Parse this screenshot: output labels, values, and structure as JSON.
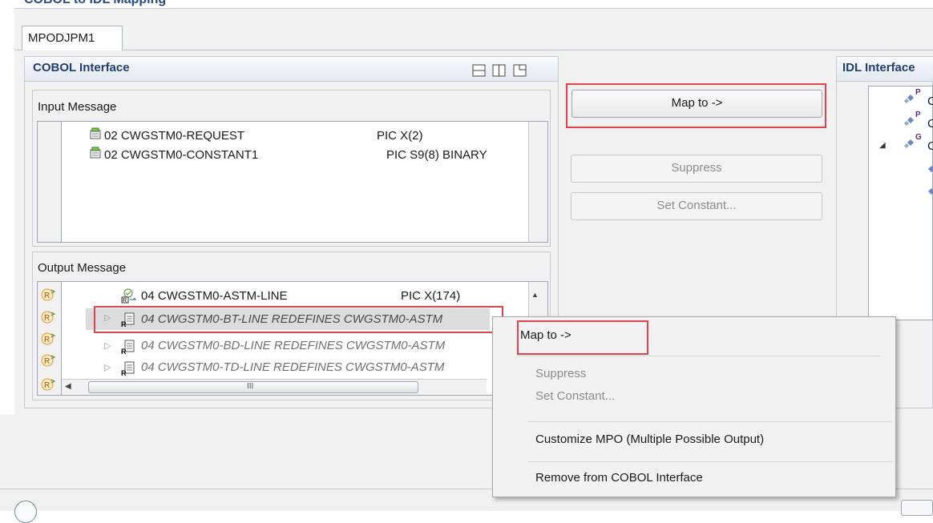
{
  "header": {
    "title": "COBOL to IDL Mapping"
  },
  "tab": {
    "label": "MPODJPM1"
  },
  "cobol": {
    "title": "COBOL Interface",
    "input": {
      "label": "Input Message",
      "rows": [
        {
          "name": "02 CWGSTM0-REQUEST",
          "pic": "PIC X(2)"
        },
        {
          "name": "02 CWGSTM0-CONSTANT1",
          "pic": "PIC S9(8) BINARY"
        }
      ]
    },
    "output": {
      "label": "Output Message",
      "rows": [
        {
          "name": "04 CWGSTM0-ASTM-LINE",
          "pic": "PIC X(174)"
        },
        {
          "name": "04 CWGSTM0-BT-LINE REDEFINES CWGSTM0-ASTM"
        },
        {
          "name": "04 CWGSTM0-BD-LINE REDEFINES CWGSTM0-ASTM"
        },
        {
          "name": "04 CWGSTM0-TD-LINE REDEFINES CWGSTM0-ASTM"
        }
      ],
      "scroll_grip": "III"
    }
  },
  "buttons": {
    "map_to": "Map to ->",
    "suppress": "Suppress",
    "set_constant": "Set Constant..."
  },
  "idl": {
    "title": "IDL Interface",
    "rows": [
      {
        "badge": "P",
        "text": "C"
      },
      {
        "badge": "P",
        "text": "C"
      },
      {
        "badge": "G",
        "text": "C"
      }
    ]
  },
  "context_menu": {
    "items": [
      "Map to ->",
      "Suppress",
      "Set Constant...",
      "Customize MPO (Multiple Possible Output)",
      "Remove from COBOL Interface"
    ]
  },
  "colors": {
    "highlight_red": "#e3414b",
    "panel_title": "#213f73",
    "icon_orange": "#e29a2c",
    "idl_diamond": "#6a87c8"
  }
}
